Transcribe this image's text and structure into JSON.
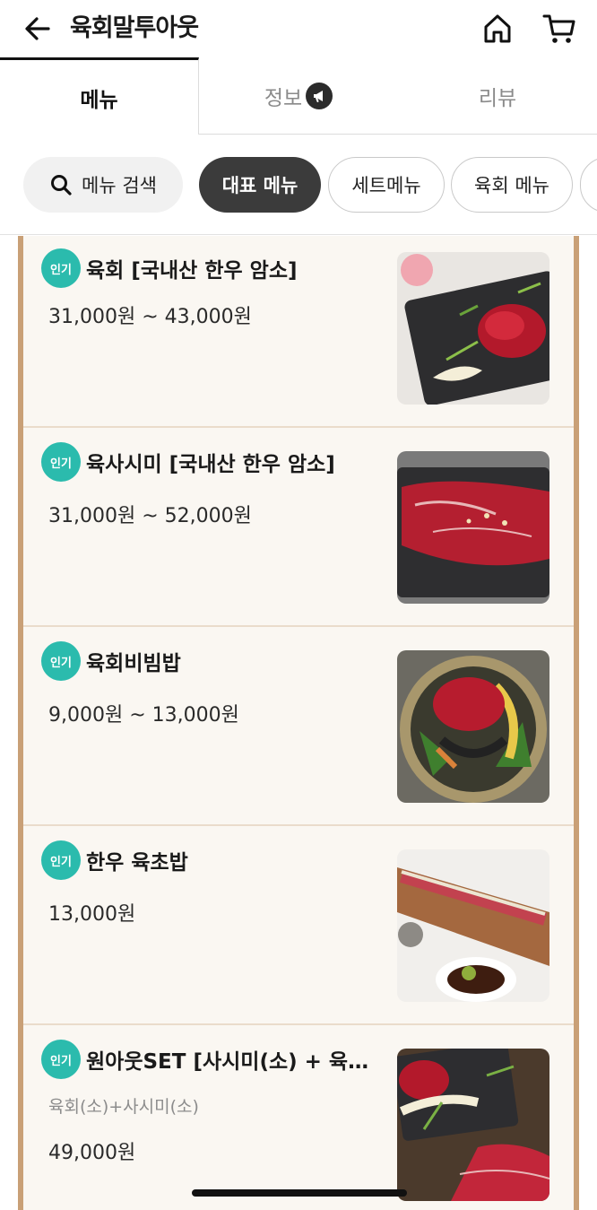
{
  "header": {
    "title": "육회말투아웃",
    "back_icon": "arrow-left-icon",
    "home_icon": "home-icon",
    "cart_icon": "cart-icon"
  },
  "tabs": [
    {
      "label": "메뉴",
      "active": true
    },
    {
      "label": "정보",
      "active": false,
      "badge_icon": "megaphone-icon"
    },
    {
      "label": "리뷰",
      "active": false
    }
  ],
  "chips": {
    "search_label": "메뉴 검색",
    "items": [
      {
        "label": "대표 메뉴",
        "selected": true
      },
      {
        "label": "세트메뉴",
        "selected": false
      },
      {
        "label": "육회 메뉴",
        "selected": false
      }
    ]
  },
  "menu_items": [
    {
      "badge": "인기",
      "name": "육회 [국내산 한우 암소]",
      "description": "",
      "price": "31,000원 ~ 43,000원",
      "image": "yukhoe-plate"
    },
    {
      "badge": "인기",
      "name": "육사시미 [국내산 한우 암소]",
      "description": "",
      "price": "31,000원 ~ 52,000원",
      "image": "sashimi-plate"
    },
    {
      "badge": "인기",
      "name": "육회비빔밥",
      "description": "",
      "price": "9,000원 ~ 13,000원",
      "image": "bibimbap-bowl"
    },
    {
      "badge": "인기",
      "name": "한우 육초밥",
      "description": "",
      "price": "13,000원",
      "image": "sushi-board"
    },
    {
      "badge": "인기",
      "name": "원아웃SET [사시미(소) + 육…",
      "description": "육회(소)+사시미(소)",
      "price": "49,000원",
      "image": "set-platter"
    }
  ],
  "colors": {
    "badge": "#2bbbad",
    "board_border": "#c9a077",
    "board_bg": "#faf7f2",
    "chip_selected": "#3b3b3b"
  }
}
